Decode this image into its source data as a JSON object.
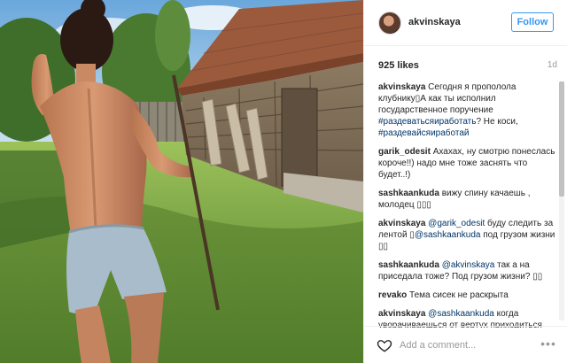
{
  "post": {
    "username": "akvinskaya",
    "follow_label": "Follow",
    "likes": "925 likes",
    "time": "1d",
    "add_comment_placeholder": "Add a comment...",
    "more_label": "•••"
  },
  "comments": [
    {
      "user": "akvinskaya",
      "parts": [
        {
          "text": "Сегодня я прополола клубнику▯А как ты исполнил государственное поручение ",
          "link": false
        },
        {
          "text": "#раздеватьсяиработать",
          "link": true
        },
        {
          "text": "? Не коси, ",
          "link": false
        },
        {
          "text": "#раздевайсяиработай",
          "link": true
        }
      ]
    },
    {
      "user": "garik_odesit",
      "parts": [
        {
          "text": "Ахахах, ну смотрю понеслась короче!!) надо мне тоже заснять что будет..!)",
          "link": false
        }
      ]
    },
    {
      "user": "sashkaankuda",
      "parts": [
        {
          "text": "вижу спину качаешь , молодец ▯▯▯",
          "link": false
        }
      ]
    },
    {
      "user": "akvinskaya",
      "parts": [
        {
          "text": "@garik_odesit",
          "link": true
        },
        {
          "text": " буду следить за лентой ▯",
          "link": false
        },
        {
          "text": "@sashkaankuda",
          "link": true
        },
        {
          "text": " под грузом жизни ▯▯",
          "link": false
        }
      ]
    },
    {
      "user": "sashkaankuda",
      "parts": [
        {
          "text": "@akvinskaya",
          "link": true
        },
        {
          "text": " так а на приседала тоже? Под грузом жизни? ▯▯",
          "link": false
        }
      ]
    },
    {
      "user": "revako",
      "parts": [
        {
          "text": "Тема сисек не раскрыта",
          "link": false
        }
      ]
    },
    {
      "user": "akvinskaya",
      "parts": [
        {
          "text": "@sashkaankuda",
          "link": true
        },
        {
          "text": " когда уворачиваешься от вертух приходиться приседать ▯▯",
          "link": false
        }
      ]
    }
  ],
  "colors": {
    "follow": "#3897f0",
    "link": "#003569",
    "muted": "#999999"
  },
  "icons": {
    "like": "heart-icon",
    "more": "more-options-icon"
  }
}
